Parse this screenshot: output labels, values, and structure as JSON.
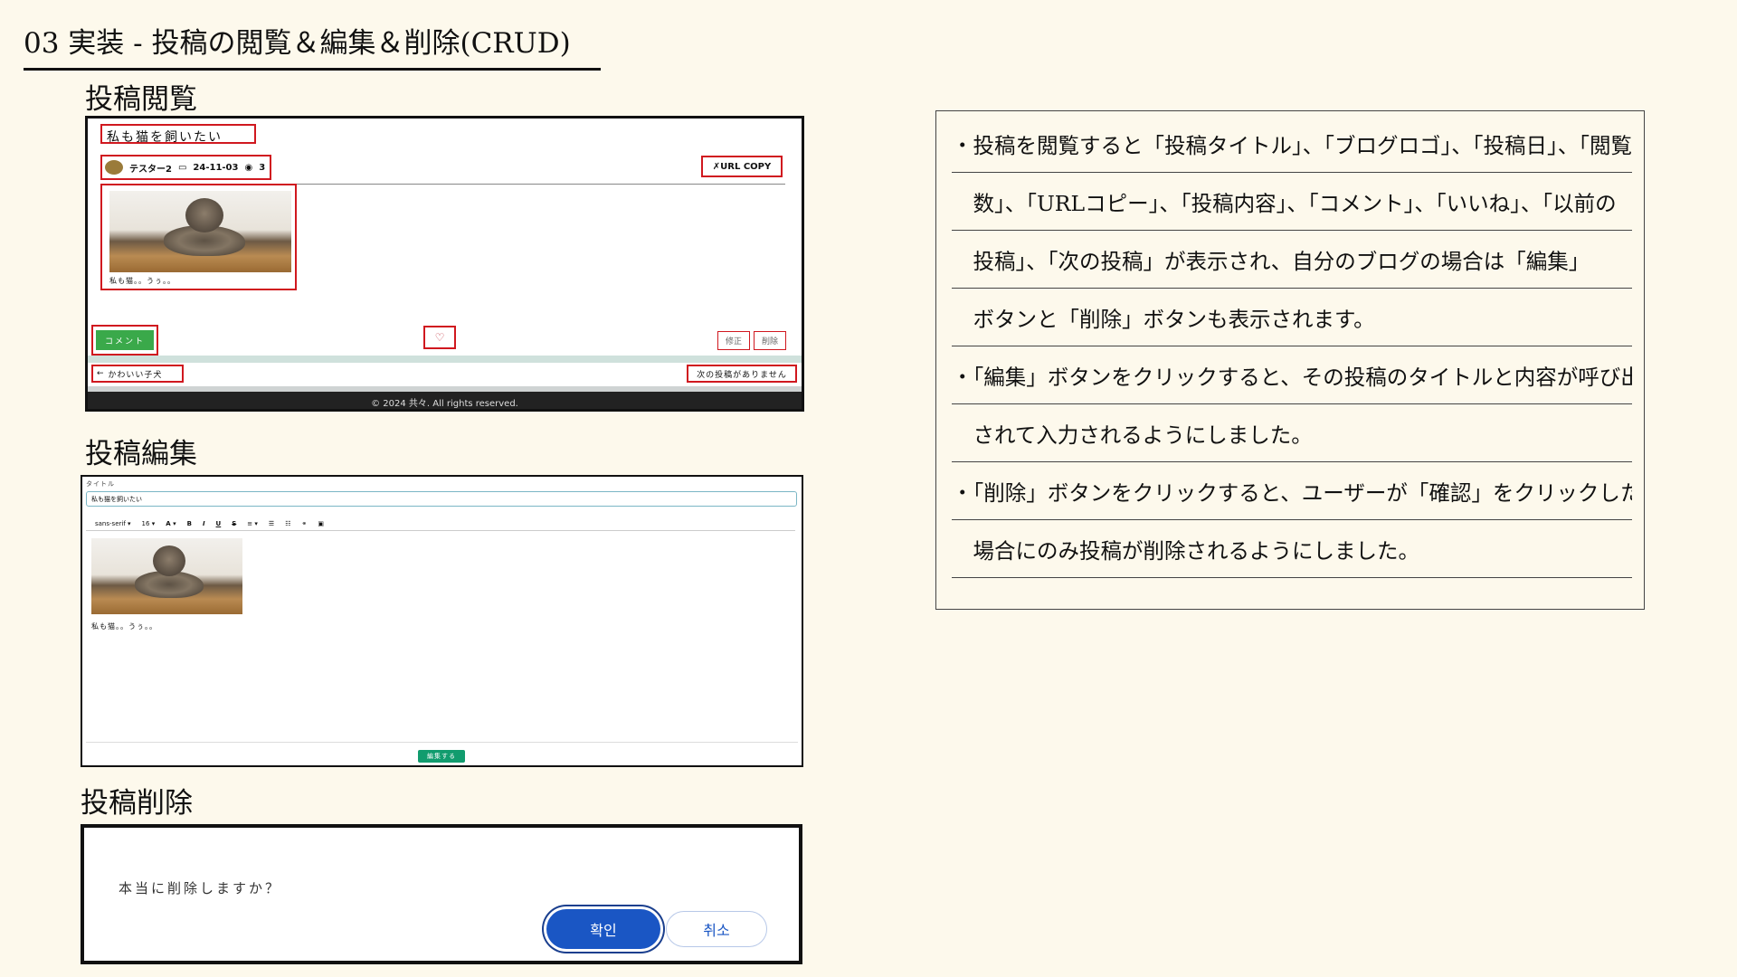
{
  "slide": {
    "title": "03 実装 - 投稿の閲覧＆編集＆削除(CRUD)",
    "sections": {
      "view": "投稿閲覧",
      "edit": "投稿編集",
      "delete": "投稿削除"
    }
  },
  "post_view": {
    "title": "私も猫を飼いたい",
    "author": "テスター2",
    "date": "24-11-03",
    "views": "3",
    "url_copy": "URL COPY",
    "content_text": "私も猫。。うぅ。。",
    "comment_button": "コメント",
    "like_icon": "heart-icon",
    "edit_button": "修正",
    "delete_button": "削除",
    "prev_post": "かわいい子犬",
    "next_post": "次の投稿がありません",
    "footer": "© 2024 共々. All rights reserved."
  },
  "post_edit": {
    "title_label": "タイトル",
    "title_value": "私も猫を飼いたい",
    "toolbar": {
      "font": "sans-serif",
      "size": "16",
      "color": "A",
      "highlight": "▾",
      "bold": "B",
      "italic": "I",
      "underline": "U",
      "strike": "S",
      "align": "≡",
      "ordered_list": "☰",
      "bullet_list": "☷",
      "link": "⚭",
      "image": "▣"
    },
    "content_text": "私も猫。。うぅ。。",
    "submit_button": "編集する"
  },
  "post_delete": {
    "message": "本当に削除しますか？",
    "confirm_button": "확인",
    "cancel_button": "취소"
  },
  "description": {
    "lines": [
      "・投稿を閲覧すると「投稿タイトル」、「ブログロゴ」、「投稿日」、「閲覧",
      "　数」、「URLコピー」、「投稿内容」、「コメント」、「いいね」、「以前の",
      "　投稿」、「次の投稿」が表示され、自分のブログの場合は「編集」",
      "　ボタンと「削除」ボタンも表示されます。",
      "・「編集」ボタンをクリックすると、その投稿のタイトルと内容が呼び出",
      "　されて入力されるようにしました。",
      "・「削除」ボタンをクリックすると、ユーザーが「確認」をクリックした",
      "　場合にのみ投稿が削除されるようにしました。"
    ]
  },
  "colors": {
    "background": "#fdf9ec",
    "highlight_red": "#d0181f",
    "comment_green": "#3aa94a",
    "submit_green": "#119c6e",
    "confirm_blue": "#1a56c4"
  }
}
